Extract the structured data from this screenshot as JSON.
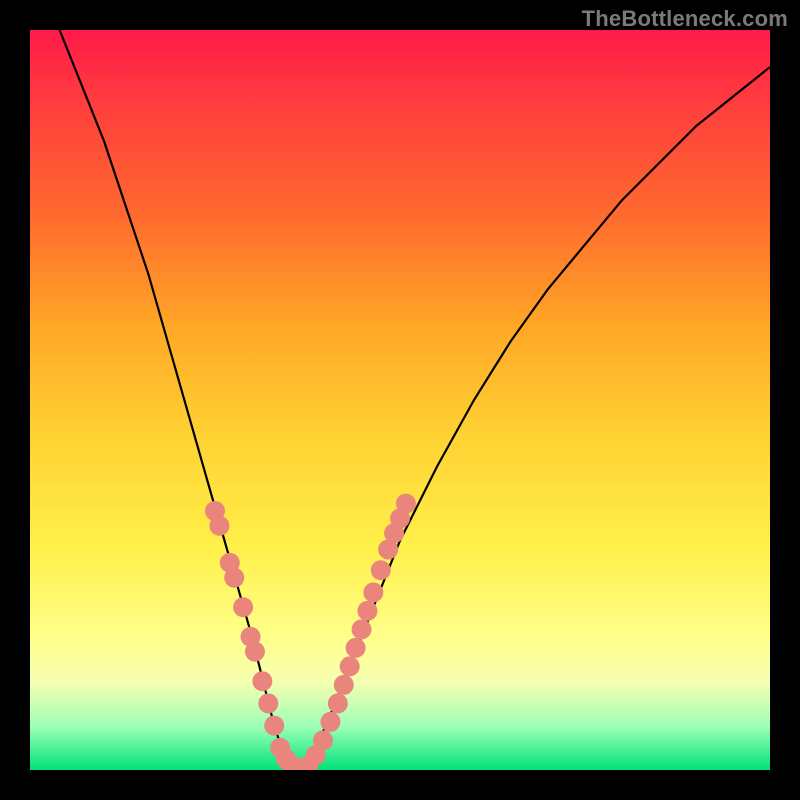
{
  "watermark": "TheBottleneck.com",
  "chart_data": {
    "type": "line",
    "title": "",
    "xlabel": "",
    "ylabel": "",
    "xlim": [
      0,
      100
    ],
    "ylim": [
      0,
      100
    ],
    "grid": false,
    "series": [
      {
        "name": "curve",
        "color": "#000000",
        "x": [
          4,
          6,
          8,
          10,
          12,
          14,
          16,
          18,
          20,
          22,
          24,
          26,
          28,
          30,
          31,
          32,
          33,
          34,
          35,
          36,
          38,
          40,
          42,
          44,
          46,
          48,
          50,
          55,
          60,
          65,
          70,
          75,
          80,
          85,
          90,
          95,
          100
        ],
        "y": [
          100,
          95,
          90,
          85,
          79,
          73,
          67,
          60,
          53,
          46,
          39,
          32,
          25,
          18,
          14,
          10,
          6,
          3,
          1,
          0,
          2,
          6,
          11,
          16,
          21,
          26,
          31,
          41,
          50,
          58,
          65,
          71,
          77,
          82,
          87,
          91,
          95
        ]
      }
    ],
    "markers": {
      "color": "#e9857d",
      "radius_pct": 1.35,
      "left_cluster": [
        {
          "x": 25.0,
          "y": 35
        },
        {
          "x": 25.6,
          "y": 33
        },
        {
          "x": 27.0,
          "y": 28
        },
        {
          "x": 27.6,
          "y": 26
        },
        {
          "x": 28.8,
          "y": 22
        },
        {
          "x": 29.8,
          "y": 18
        },
        {
          "x": 30.4,
          "y": 16
        },
        {
          "x": 31.4,
          "y": 12
        },
        {
          "x": 32.2,
          "y": 9
        },
        {
          "x": 33.0,
          "y": 6
        },
        {
          "x": 33.8,
          "y": 3
        },
        {
          "x": 34.6,
          "y": 1.5
        },
        {
          "x": 35.4,
          "y": 0.6
        },
        {
          "x": 36.4,
          "y": 0.2
        }
      ],
      "right_cluster": [
        {
          "x": 37.6,
          "y": 0.6
        },
        {
          "x": 38.6,
          "y": 2
        },
        {
          "x": 39.6,
          "y": 4
        },
        {
          "x": 40.6,
          "y": 6.5
        },
        {
          "x": 41.6,
          "y": 9
        },
        {
          "x": 42.4,
          "y": 11.5
        },
        {
          "x": 43.2,
          "y": 14
        },
        {
          "x": 44.0,
          "y": 16.5
        },
        {
          "x": 44.8,
          "y": 19
        },
        {
          "x": 45.6,
          "y": 21.5
        },
        {
          "x": 46.4,
          "y": 24
        },
        {
          "x": 47.4,
          "y": 27
        },
        {
          "x": 48.4,
          "y": 29.8
        },
        {
          "x": 49.2,
          "y": 32
        },
        {
          "x": 50.0,
          "y": 34
        },
        {
          "x": 50.8,
          "y": 36
        }
      ]
    }
  }
}
